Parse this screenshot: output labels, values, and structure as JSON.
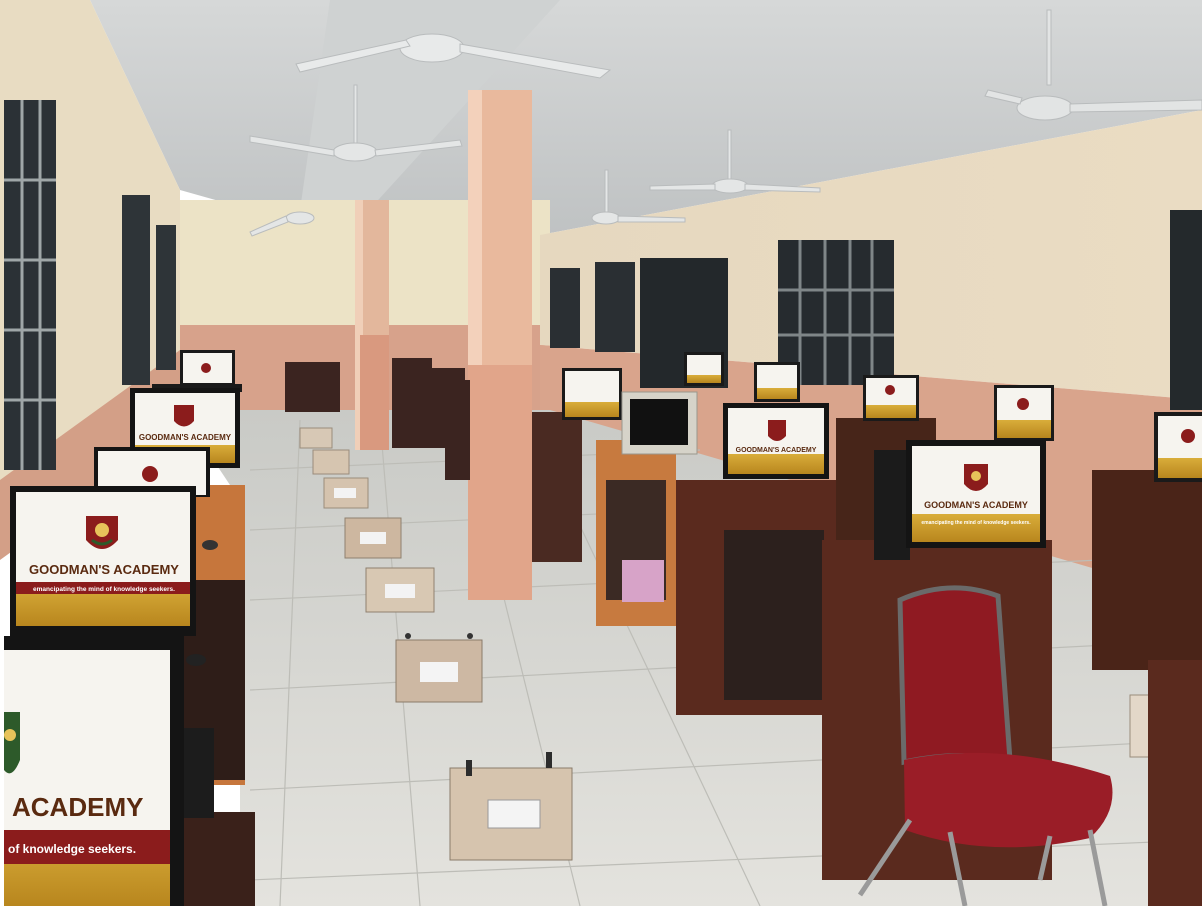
{
  "scene": {
    "brand_name": "GOODMAN'S ACADEMY",
    "brand_tagline": "emancipating the mind of knowledge seekers.",
    "large_screen_brand": "ACADEMY",
    "large_screen_tagline": "of knowledge seekers.",
    "colors": {
      "wall_upper": "#e9ddc3",
      "wall_lower": "#d9a48c",
      "floor": "#dcdcd7",
      "pillar": "#e8b79b",
      "desk_wood": "#5a2a1e",
      "chair_seat": "#8f1a22",
      "screen_white": "#f6f4ef",
      "screen_gold": "#c79a2c",
      "logo_red": "#8b1c1c"
    },
    "icons": [
      "ceiling-fan-icon",
      "academy-logo-icon",
      "power-socket-icon"
    ]
  }
}
